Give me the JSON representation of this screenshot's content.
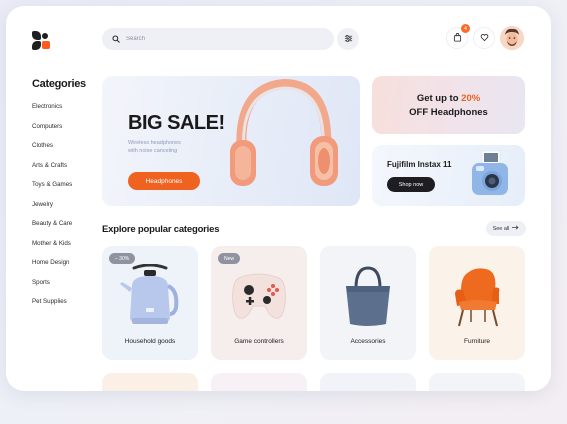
{
  "search": {
    "placeholder": "Search"
  },
  "header": {
    "cart_badge": "4",
    "icons": [
      "search-icon",
      "filter-icon",
      "bag-icon",
      "heart-icon"
    ]
  },
  "sidebar": {
    "title": "Categories",
    "items": [
      "Electronics",
      "Computers",
      "Clothes",
      "Arts & Crafts",
      "Toys & Games",
      "Jewelry",
      "Beauty & Care",
      "Mother & Kids",
      "Home Design",
      "Sports",
      "Pet Supplies"
    ]
  },
  "hero": {
    "title": "BIG SALE!",
    "subtitle_line1": "Wireless headphones",
    "subtitle_line2": "with noise canceling",
    "button": "Headphones"
  },
  "promo_discount": {
    "line1_prefix": "Get up to ",
    "line1_highlight": "20%",
    "line2": "OFF Headphones"
  },
  "promo_camera": {
    "title": "Fujifilm Instax 11",
    "button": "Shop now"
  },
  "section": {
    "title": "Explore popular categories",
    "see_all": "See all"
  },
  "cards": [
    {
      "label": "Household goods",
      "tag": "– 30%"
    },
    {
      "label": "Game controllers",
      "tag": "New"
    },
    {
      "label": "Accessories",
      "tag": ""
    },
    {
      "label": "Furniture",
      "tag": ""
    }
  ],
  "colors": {
    "accent": "#f0621f",
    "dark": "#1e1e22",
    "background": "#eef0f6"
  }
}
